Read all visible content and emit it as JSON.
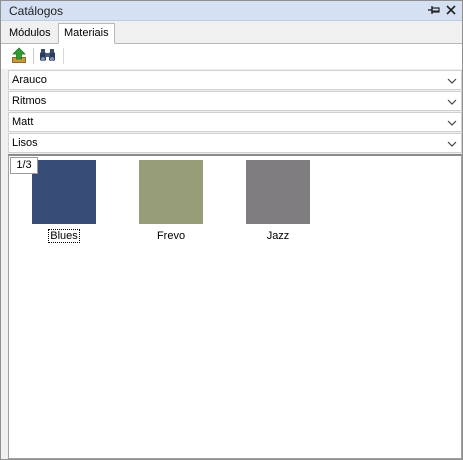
{
  "window": {
    "title": "Catálogos"
  },
  "tabs": [
    {
      "label": "Módulos",
      "active": false
    },
    {
      "label": "Materiais",
      "active": true
    }
  ],
  "toolbar": {
    "icons": [
      "upload-green-arrow-icon",
      "binoculars-icon"
    ]
  },
  "filters": [
    {
      "value": "Arauco"
    },
    {
      "value": "Ritmos"
    },
    {
      "value": "Matt"
    },
    {
      "value": "Lisos"
    }
  ],
  "gallery": {
    "page_indicator": "1/3",
    "items": [
      {
        "label": "Blues",
        "color": "#374c76",
        "selected": true
      },
      {
        "label": "Frevo",
        "color": "#979d77",
        "selected": false
      },
      {
        "label": "Jazz",
        "color": "#807d81",
        "selected": false
      }
    ]
  }
}
